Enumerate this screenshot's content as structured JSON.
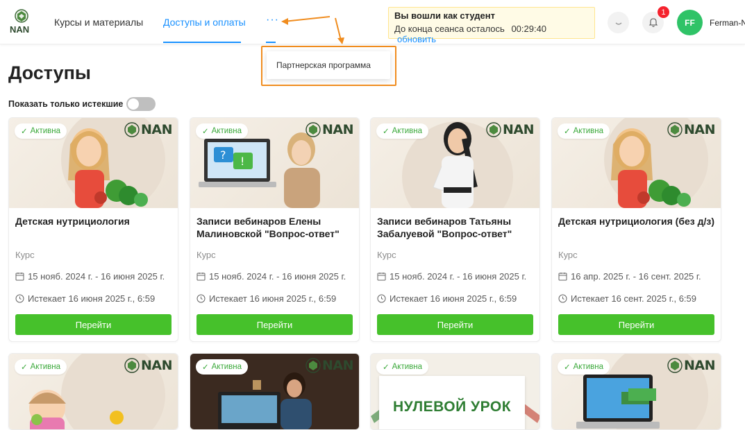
{
  "header": {
    "logo_text": "NAN",
    "nav": [
      {
        "label": "Курсы и материалы"
      },
      {
        "label": "Доступы и оплаты"
      }
    ],
    "more_label": "···",
    "session": {
      "title": "Вы вошли как студент",
      "remaining_label": "До конца сеанса осталось",
      "remaining_time": "00:29:40",
      "refresh_label": "обновить"
    },
    "notifications_count": "1",
    "avatar_initials": "FF",
    "username": "Ferman-N"
  },
  "dropdown": {
    "items": [
      {
        "label": "Партнерская программа"
      }
    ]
  },
  "page": {
    "title": "Доступы",
    "filter_label": "Показать только истекшие",
    "filter_on": false
  },
  "cards": [
    {
      "status": "Активна",
      "title": "Детская нутрициология",
      "type": "Курс",
      "dates": "15 нояб. 2024 г. - 16 июня 2025 г.",
      "expires": "Истекает 16 июня 2025 г., 6:59",
      "button": "Перейти"
    },
    {
      "status": "Активна",
      "title": "Записи вебинаров Елены Малиновской \"Вопрос-ответ\"",
      "type": "Курс",
      "dates": "15 нояб. 2024 г. - 16 июня 2025 г.",
      "expires": "Истекает 16 июня 2025 г., 6:59",
      "button": "Перейти"
    },
    {
      "status": "Активна",
      "title": "Записи вебинаров Татьяны Забалуевой \"Вопрос-ответ\"",
      "type": "Курс",
      "dates": "15 нояб. 2024 г. - 16 июня 2025 г.",
      "expires": "Истекает 16 июня 2025 г., 6:59",
      "button": "Перейти"
    },
    {
      "status": "Активна",
      "title": "Детская нутрициология (без д/з)",
      "type": "Курс",
      "dates": "16 апр. 2025 г. - 16 сент. 2025 г.",
      "expires": "Истекает 16 сент. 2025 г., 6:59",
      "button": "Перейти"
    }
  ],
  "cards_row2": [
    {
      "status": "Активна"
    },
    {
      "status": "Активна"
    },
    {
      "status": "Активна",
      "banner": "НУЛЕВОЙ УРОК"
    },
    {
      "status": "Активна"
    }
  ],
  "colors": {
    "accent": "#1890ff",
    "button": "#46c12b",
    "status": "#3aa83a",
    "highlight": "#f08c1e",
    "avatar": "#2fc367",
    "badge": "#f5222d"
  }
}
